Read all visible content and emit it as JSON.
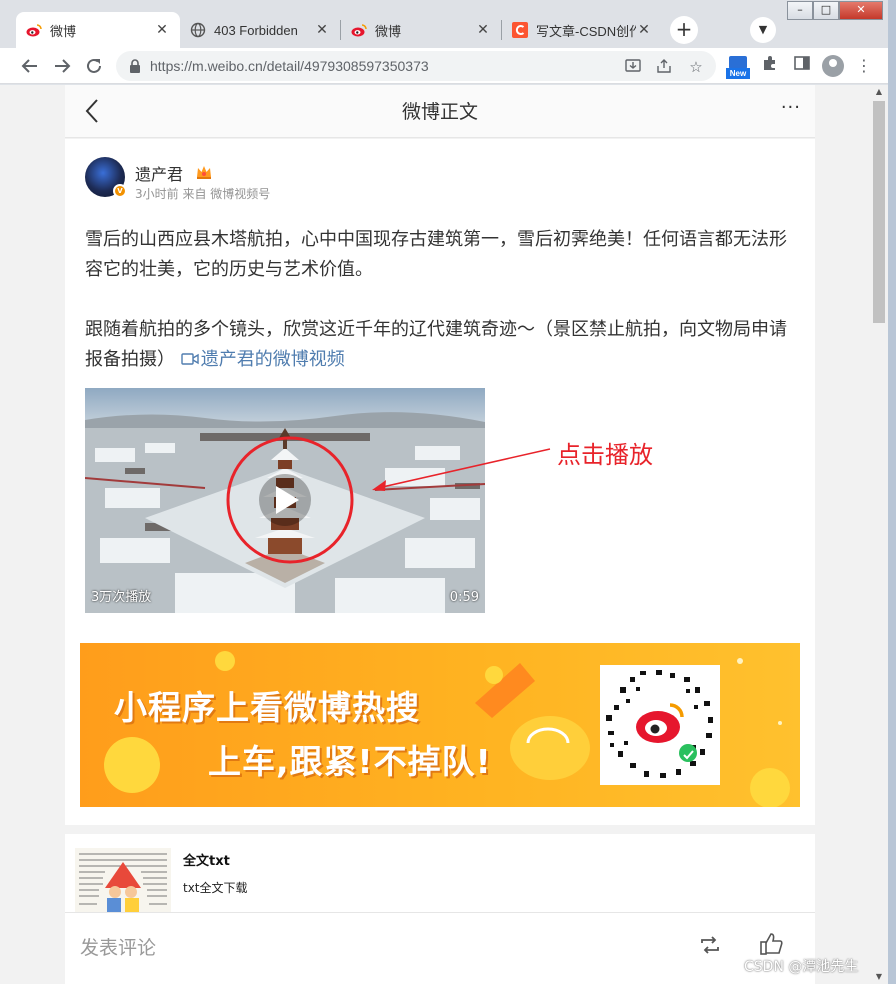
{
  "browser": {
    "tabs": [
      {
        "title": "微博",
        "icon": "weibo-icon",
        "active": true
      },
      {
        "title": "403 Forbidden",
        "icon": "globe-icon",
        "active": false
      },
      {
        "title": "微博",
        "icon": "weibo-icon",
        "active": false
      },
      {
        "title": "写文章-CSDN创作",
        "icon": "csdn-icon",
        "active": false
      }
    ],
    "close_glyph": "✕",
    "new_tab_glyph": "+",
    "url": "https://m.weibo.cn/detail/4979308597350373",
    "new_badge": "New",
    "window_controls": {
      "minimize": "–",
      "maximize": "□",
      "close": "✕"
    }
  },
  "page": {
    "header": {
      "title": "微博正文",
      "more": "···"
    },
    "post": {
      "author": "遗产君",
      "meta": "3小时前 来自 微博视频号",
      "paragraph1": "雪后的山西应县木塔航拍，心中中国现存古建筑第一，雪后初霁绝美！任何语言都无法形容它的壮美，它的历史与艺术价值。",
      "paragraph2": "跟随着航拍的多个镜头，欣赏这近千年的辽代建筑奇迹～（景区禁止航拍，向文物局申请报备拍摄）",
      "video_link": "遗产君的微博视频",
      "video": {
        "plays": "3万次播放",
        "duration": "0:59"
      }
    },
    "annotation": "点击播放",
    "banner": {
      "line1": "小程序上看微博热搜",
      "line2": "上车,跟紧!不掉队!"
    },
    "ad": {
      "title": "全文txt",
      "subtitle": "txt全文下载"
    },
    "bottom_bar": {
      "comment_placeholder": "发表评论"
    },
    "watermark": "CSDN @潭池先生"
  },
  "colors": {
    "annotation_red": "#e8232a",
    "link_blue": "#507daf",
    "banner_orange": "#ffa620"
  }
}
